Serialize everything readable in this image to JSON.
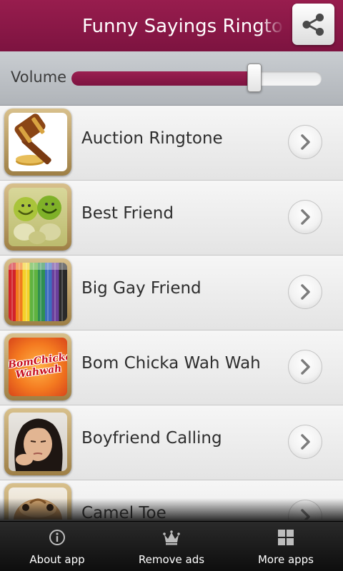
{
  "header": {
    "title": "Funny Sayings Ringtones",
    "share_icon": "share-icon",
    "bg_color": "#8a1844"
  },
  "volume": {
    "label": "Volume",
    "level_fraction": 0.73,
    "fill_color": "#9a1f50"
  },
  "list": {
    "items": [
      {
        "label": "Auction Ringtone",
        "thumb": "gavel"
      },
      {
        "label": "Best Friend",
        "thumb": "smiley-peas"
      },
      {
        "label": "Big Gay Friend",
        "thumb": "rainbow-stripes"
      },
      {
        "label": "Bom Chicka Wah Wah",
        "thumb": "bom-chicka-logo",
        "thumb_text": "BomChicka Wahwah"
      },
      {
        "label": "Boyfriend Calling",
        "thumb": "bored-girl"
      },
      {
        "label": "Camel Toe",
        "thumb": "camel"
      }
    ],
    "chevron_icon": "chevron-right-icon"
  },
  "bottom_nav": {
    "items": [
      {
        "label": "About app",
        "icon": "info-icon"
      },
      {
        "label": "Remove ads",
        "icon": "crown-icon"
      },
      {
        "label": "More apps",
        "icon": "grid-icon"
      }
    ]
  }
}
